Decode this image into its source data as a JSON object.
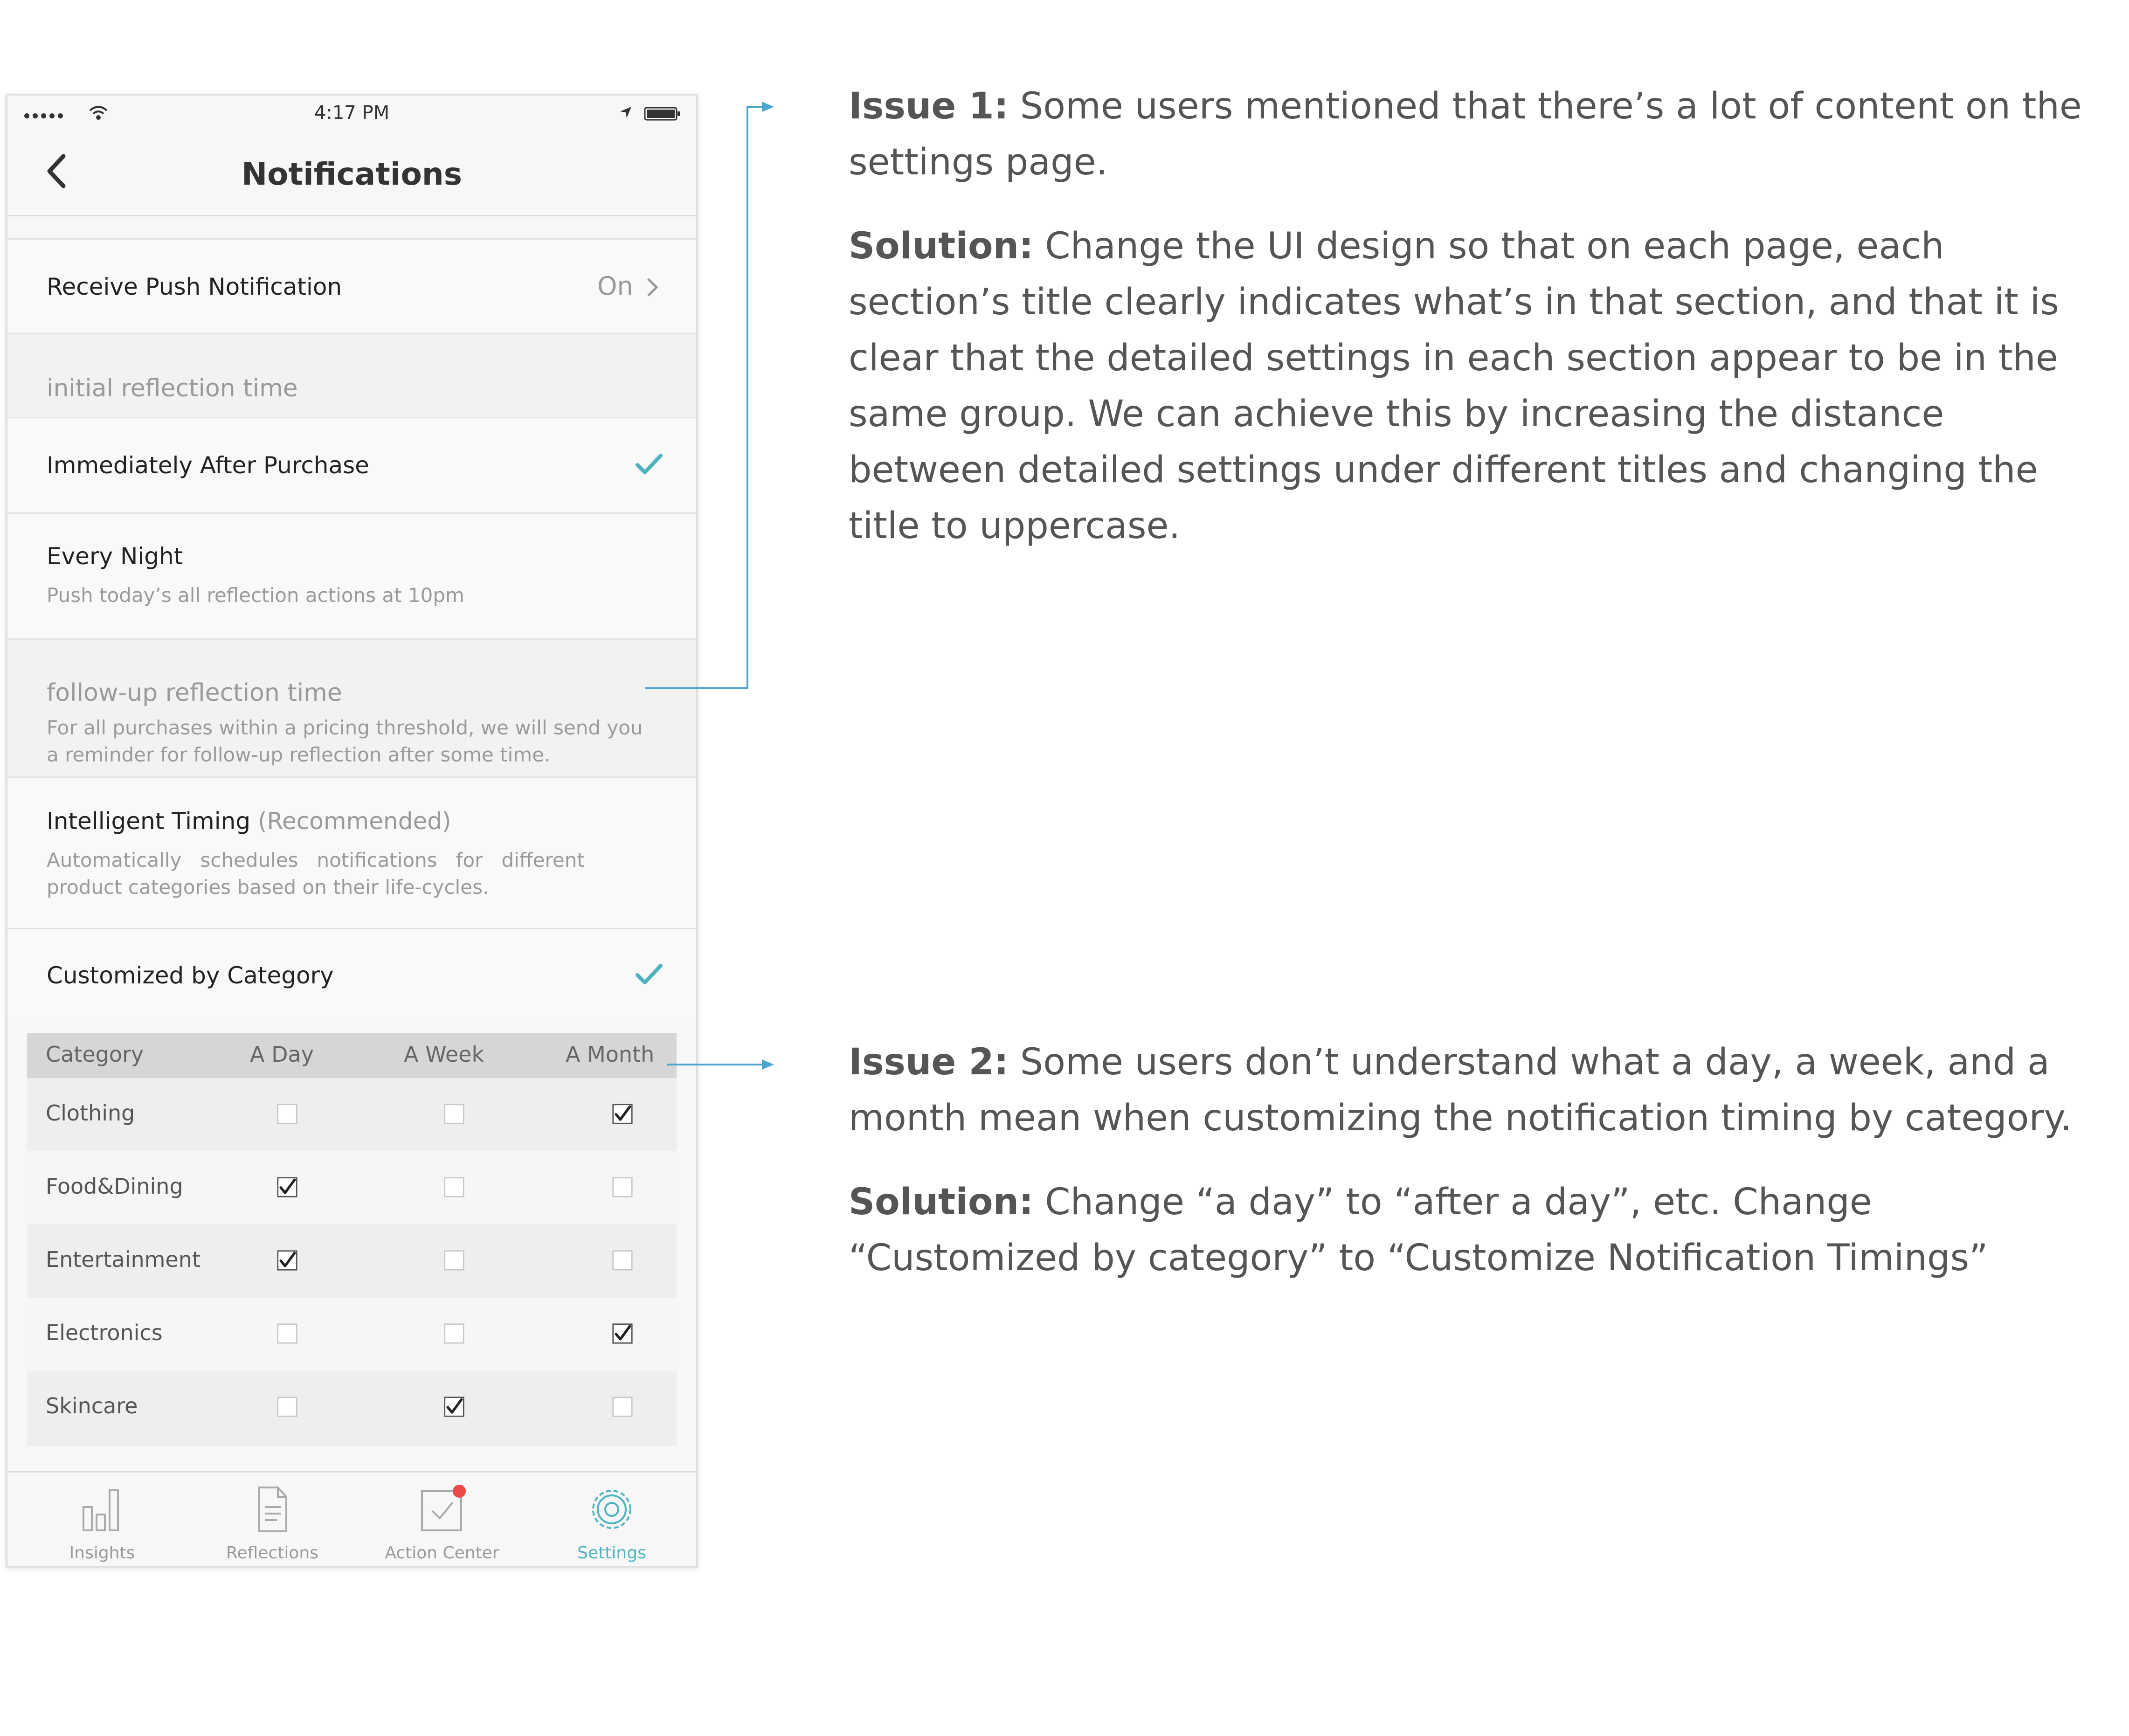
{
  "status_bar": {
    "time": "4:17 PM"
  },
  "nav": {
    "title": "Notifications"
  },
  "push": {
    "label": "Receive Push Notification",
    "value": "On"
  },
  "initial_section": {
    "header": "initial reflection time"
  },
  "option_immediately": {
    "label": "Immediately After Purchase"
  },
  "option_every_night": {
    "label": "Every Night",
    "sub": "Push today’s all reflection actions at 10pm"
  },
  "followup_section": {
    "header": "follow-up reflection time",
    "desc1": "For all purchases within a pricing threshold, we will send you",
    "desc2": "a reminder for follow-up reflection after some time."
  },
  "option_intelligent": {
    "label": "Intelligent Timing",
    "tag": "(Recommended)",
    "sub1": "Automatically   schedules   notifications   for   different",
    "sub2": "product categories based on their life-cycles."
  },
  "option_custom": {
    "label": "Customized by Category"
  },
  "table": {
    "headers": [
      "Category",
      "A Day",
      "A Week",
      "A Month"
    ],
    "rows": [
      {
        "name": "Clothing",
        "checks": [
          false,
          false,
          true
        ]
      },
      {
        "name": "Food&Dining",
        "checks": [
          true,
          false,
          false
        ]
      },
      {
        "name": "Entertainment",
        "checks": [
          true,
          false,
          false
        ]
      },
      {
        "name": "Electronics",
        "checks": [
          false,
          false,
          true
        ]
      },
      {
        "name": "Skincare",
        "checks": [
          false,
          true,
          false
        ]
      }
    ]
  },
  "tabs": [
    {
      "label": "Insights",
      "icon": "bar-chart-icon"
    },
    {
      "label": "Reflections",
      "icon": "document-icon"
    },
    {
      "label": "Action Center",
      "icon": "checkbox-badge-icon"
    },
    {
      "label": "Settings",
      "icon": "gear-icon",
      "active": true
    }
  ],
  "colors": {
    "accent": "#4fb3bf",
    "badge": "#e84a4a",
    "arrow": "#4aa6cf"
  },
  "annotations": {
    "issue1": {
      "label": "Issue 1:",
      "text": "Some users mentioned that there’s a lot of content on the settings page.",
      "solution_label": "Solution:",
      "solution": "Change the UI design so that on each page, each section’s title clearly indicates what’s in that section, and that it is clear that the detailed settings in each section appear to be in the same group. We can achieve this by increasing the distance between detailed settings under different titles and changing the title to uppercase."
    },
    "issue2": {
      "label": "Issue 2:",
      "text": "Some users don’t understand what a day, a week, and a month mean when customizing the notification timing by category.",
      "solution_label": "Solution:",
      "solution": "Change “a day” to “after a day”, etc. Change “Customized by category” to “Customize Notification Timings”"
    }
  }
}
